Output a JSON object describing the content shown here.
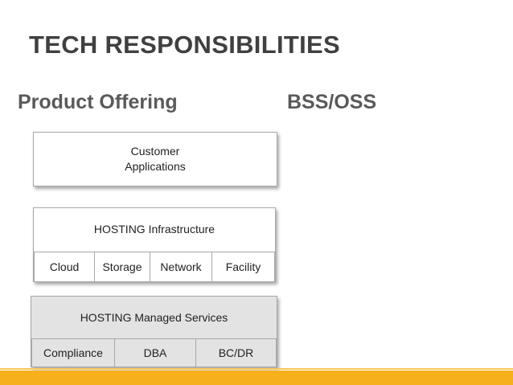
{
  "title": "TECH RESPONSIBILITIES",
  "left_heading": "Product Offering",
  "right_heading": "BSS/OSS",
  "customer_box": {
    "line1": "Customer",
    "line2": "Applications"
  },
  "infrastructure": {
    "label": "HOSTING Infrastructure",
    "cells": [
      "Cloud",
      "Storage",
      "Network",
      "Facility"
    ]
  },
  "managed_services": {
    "label": "HOSTING Managed Services",
    "cells": [
      "Compliance",
      "DBA",
      "BC/DR"
    ]
  },
  "colors": {
    "accent": "#f5b01b",
    "title": "#404040",
    "panel_grey": "#e3e3e3"
  }
}
